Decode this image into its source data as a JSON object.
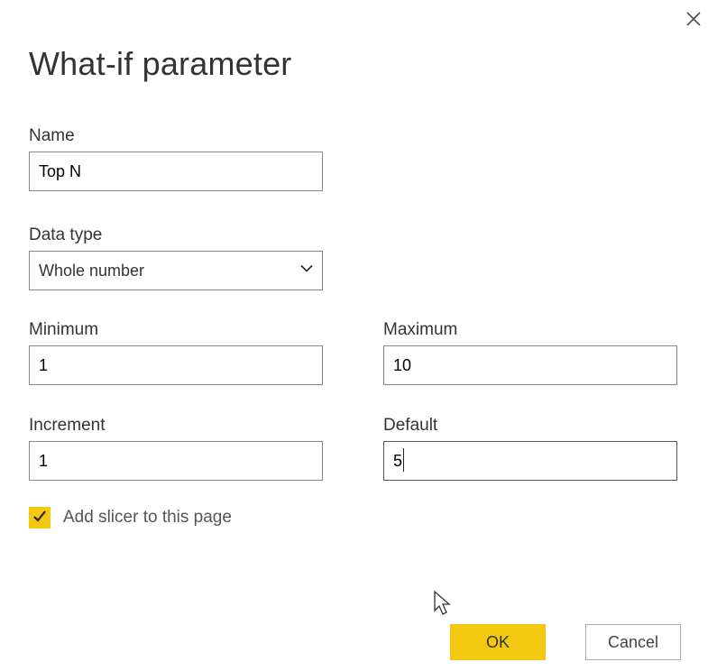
{
  "dialog": {
    "title": "What-if parameter"
  },
  "fields": {
    "name": {
      "label": "Name",
      "value": "Top N"
    },
    "datatype": {
      "label": "Data type",
      "value": "Whole number"
    },
    "minimum": {
      "label": "Minimum",
      "value": "1"
    },
    "maximum": {
      "label": "Maximum",
      "value": "10"
    },
    "increment": {
      "label": "Increment",
      "value": "1"
    },
    "default": {
      "label": "Default",
      "value": "5"
    }
  },
  "checkbox": {
    "add_slicer_label": "Add slicer to this page",
    "checked": true
  },
  "buttons": {
    "ok": "OK",
    "cancel": "Cancel"
  },
  "colors": {
    "accent": "#F2C811"
  }
}
